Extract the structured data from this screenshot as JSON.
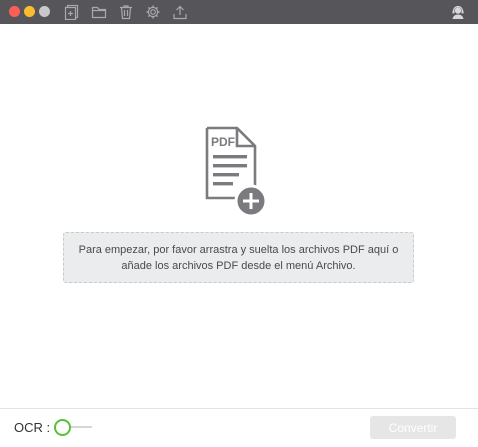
{
  "window": {
    "traffic_lights": [
      "close",
      "minimize",
      "zoom"
    ]
  },
  "toolbar": {
    "icons": [
      "new-document-icon",
      "folder-icon",
      "trash-icon",
      "settings-gear-icon",
      "upload-icon",
      "support-agent-icon"
    ]
  },
  "main": {
    "pdf_icon_label": "PDF",
    "dropzone_text": "Para empezar, por favor arrastra y suelta los archivos PDF aquí o añade los archivos PDF desde el menú Archivo."
  },
  "footer": {
    "ocr_label": "OCR :",
    "ocr_enabled": false,
    "convert_label": "Convertir",
    "convert_enabled": false
  },
  "colors": {
    "titlebar": "#56565a",
    "toggle_accent": "#5bbf3a",
    "icon_gray": "#6e6e72"
  }
}
